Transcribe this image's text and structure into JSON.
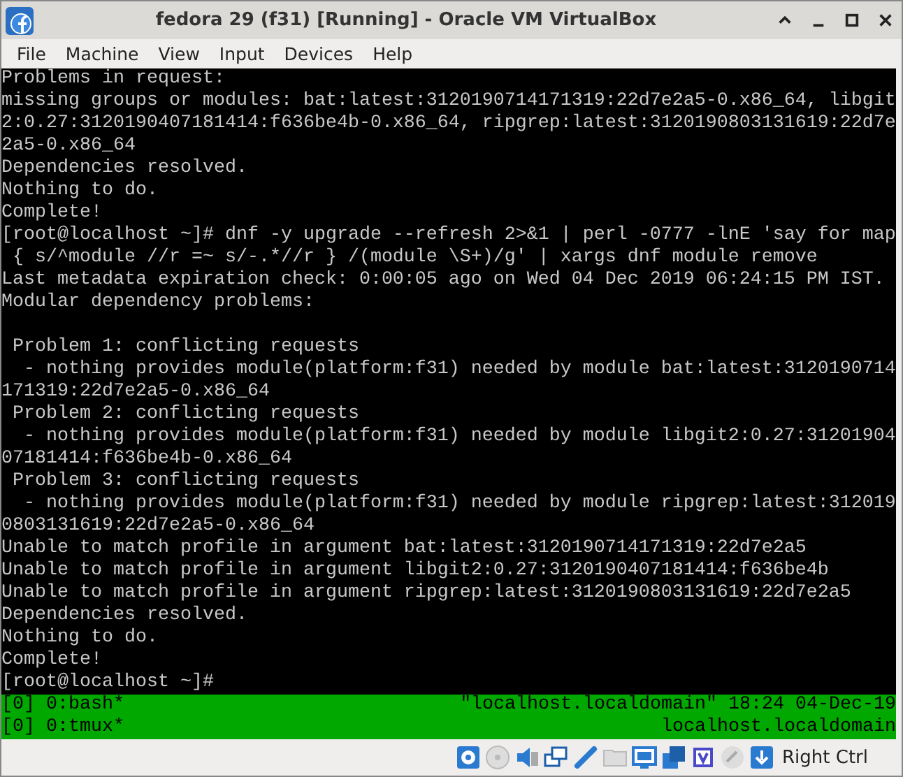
{
  "window": {
    "title": "fedora 29 (f31) [Running] - Oracle VM VirtualBox"
  },
  "menu": [
    "File",
    "Machine",
    "View",
    "Input",
    "Devices",
    "Help"
  ],
  "terminal": {
    "lines": [
      {
        "kind": "text",
        "text": "Problems in request:"
      },
      {
        "kind": "text",
        "text": "missing groups or modules: bat:latest:3120190714171319:22d7e2a5-0.x86_64, libgit"
      },
      {
        "kind": "text",
        "text": "2:0.27:3120190407181414:f636be4b-0.x86_64, ripgrep:latest:3120190803131619:22d7e"
      },
      {
        "kind": "text",
        "text": "2a5-0.x86_64"
      },
      {
        "kind": "text",
        "text": "Dependencies resolved."
      },
      {
        "kind": "text",
        "text": "Nothing to do."
      },
      {
        "kind": "text",
        "text": "Complete!"
      },
      {
        "kind": "text",
        "text": "[root@localhost ~]# dnf -y upgrade --refresh 2>&1 | perl -0777 -lnE 'say for map"
      },
      {
        "kind": "text",
        "text": " { s/^module //r =~ s/-.*//r } /(module \\S+)/g' | xargs dnf module remove"
      },
      {
        "kind": "text",
        "text": "Last metadata expiration check: 0:00:05 ago on Wed 04 Dec 2019 06:24:15 PM IST."
      },
      {
        "kind": "text",
        "text": "Modular dependency problems:"
      },
      {
        "kind": "blank"
      },
      {
        "kind": "text",
        "text": " Problem 1: conflicting requests"
      },
      {
        "kind": "text",
        "text": "  - nothing provides module(platform:f31) needed by module bat:latest:3120190714"
      },
      {
        "kind": "text",
        "text": "171319:22d7e2a5-0.x86_64"
      },
      {
        "kind": "text",
        "text": " Problem 2: conflicting requests"
      },
      {
        "kind": "text",
        "text": "  - nothing provides module(platform:f31) needed by module libgit2:0.27:31201904"
      },
      {
        "kind": "text",
        "text": "07181414:f636be4b-0.x86_64"
      },
      {
        "kind": "text",
        "text": " Problem 3: conflicting requests"
      },
      {
        "kind": "text",
        "text": "  - nothing provides module(platform:f31) needed by module ripgrep:latest:312019"
      },
      {
        "kind": "text",
        "text": "0803131619:22d7e2a5-0.x86_64"
      },
      {
        "kind": "text",
        "text": "Unable to match profile in argument bat:latest:3120190714171319:22d7e2a5"
      },
      {
        "kind": "text",
        "text": "Unable to match profile in argument libgit2:0.27:3120190407181414:f636be4b"
      },
      {
        "kind": "text",
        "text": "Unable to match profile in argument ripgrep:latest:3120190803131619:22d7e2a5"
      },
      {
        "kind": "text",
        "text": "Dependencies resolved."
      },
      {
        "kind": "text",
        "text": "Nothing to do."
      },
      {
        "kind": "text",
        "text": "Complete!"
      },
      {
        "kind": "text",
        "text": "[root@localhost ~]#"
      }
    ],
    "status_lines": [
      {
        "left": "[0] 0:bash*",
        "right": "\"localhost.localdomain\" 18:24 04-Dec-19"
      },
      {
        "left": "[0] 0:tmux*",
        "right": "localhost.localdomain"
      }
    ]
  },
  "status_bar": {
    "host_key": "Right Ctrl"
  }
}
